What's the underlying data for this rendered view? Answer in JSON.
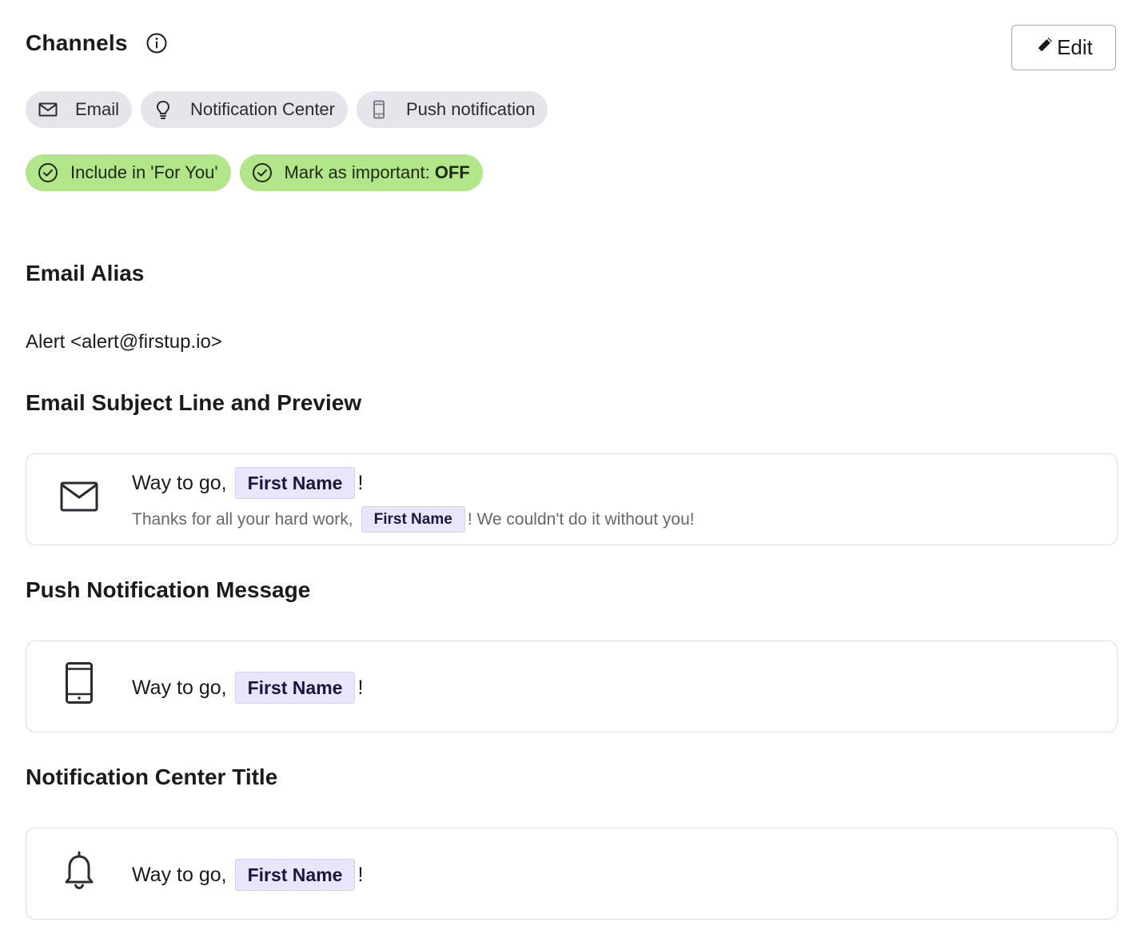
{
  "header": {
    "title": "Channels",
    "info_icon": "info-circle-icon",
    "edit_label": "Edit",
    "edit_icon": "pencil-icon"
  },
  "channels": [
    {
      "label": "Email",
      "icon": "envelope-icon"
    },
    {
      "label": "Notification Center",
      "icon": "lightbulb-icon"
    },
    {
      "label": "Push notification",
      "icon": "mobile-phone-icon"
    }
  ],
  "flags": {
    "for_you": {
      "label": "Include in 'For You'",
      "icon": "check-circle-icon"
    },
    "important": {
      "label": "Mark as important:",
      "value": "OFF",
      "icon": "check-circle-icon"
    }
  },
  "email_alias": {
    "heading": "Email Alias",
    "value": "Alert <alert@firstup.io>"
  },
  "email_subject": {
    "heading": "Email Subject Line and Preview",
    "icon": "envelope-icon",
    "subject_prefix": "Way to go,",
    "subject_token": "First Name",
    "subject_suffix": "!",
    "preview_prefix": "Thanks for all your hard work,",
    "preview_token": "First Name",
    "preview_suffix": "! We couldn't do it without you!"
  },
  "push_message": {
    "heading": "Push Notification Message",
    "icon": "mobile-phone-icon",
    "prefix": "Way to go,",
    "token": "First Name",
    "suffix": "!"
  },
  "notification_center": {
    "heading": "Notification Center Title",
    "icon": "bell-icon",
    "prefix": "Way to go,",
    "token": "First Name",
    "suffix": "!"
  },
  "colors": {
    "chip_gray": "#e6e5ec",
    "chip_green": "#b3e58a",
    "token_bg": "#e8e6fb"
  }
}
